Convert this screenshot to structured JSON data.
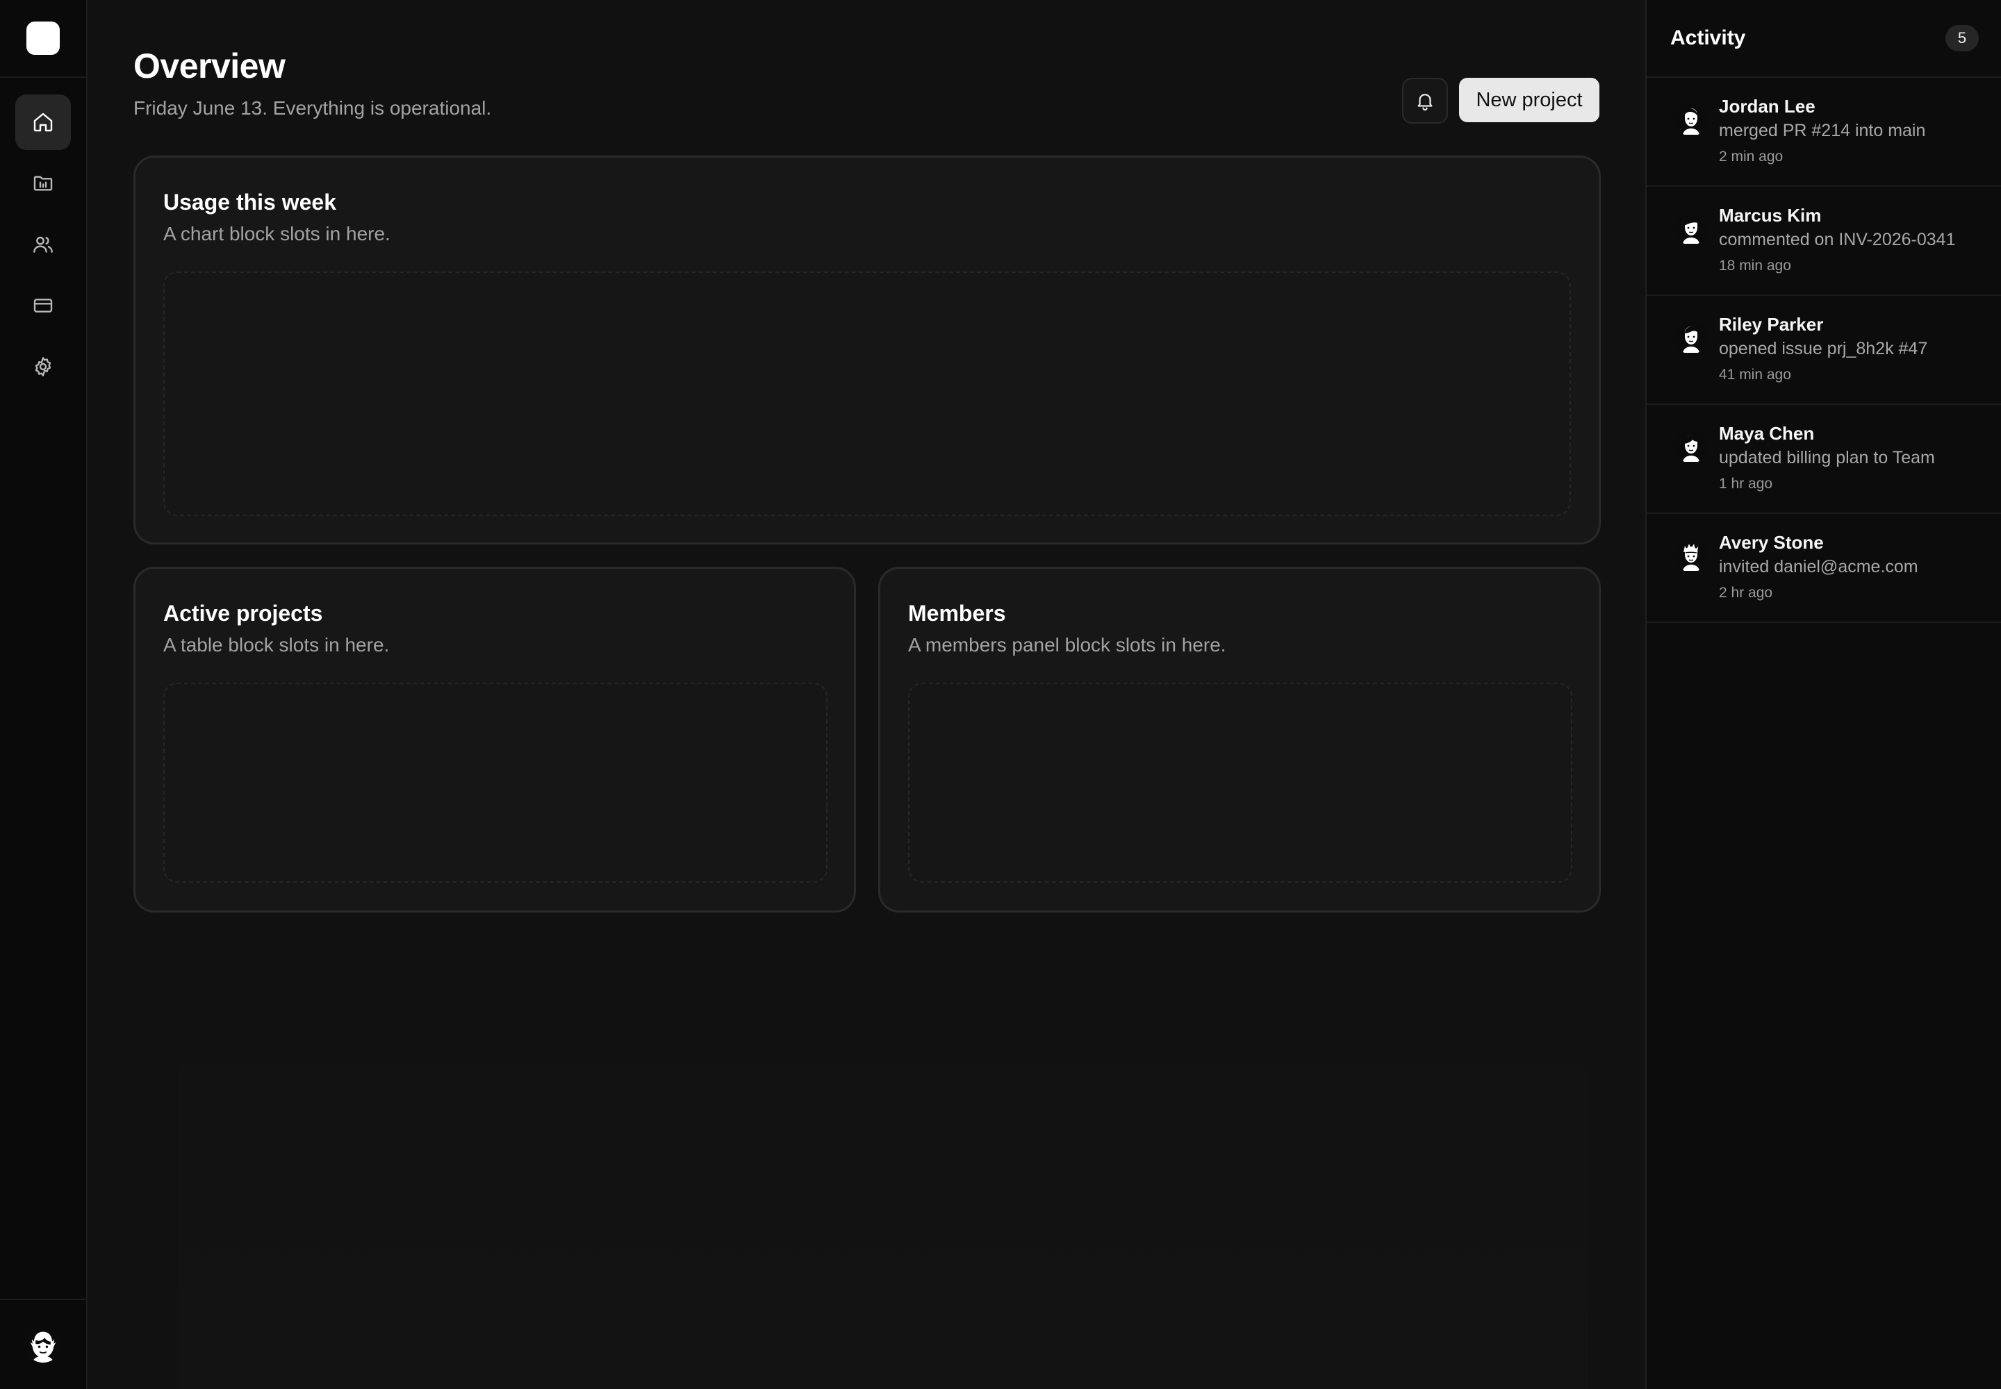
{
  "sidebar": {
    "nav": [
      {
        "icon": "home-icon",
        "active": true
      },
      {
        "icon": "folder-icon",
        "active": false
      },
      {
        "icon": "users-icon",
        "active": false
      },
      {
        "icon": "credit-card-icon",
        "active": false
      },
      {
        "icon": "gear-icon",
        "active": false
      }
    ]
  },
  "header": {
    "title": "Overview",
    "subtitle": "Friday June 13. Everything is operational.",
    "new_project_label": "New project"
  },
  "cards": {
    "usage": {
      "title": "Usage this week",
      "description": "A chart block slots in here."
    },
    "projects": {
      "title": "Active projects",
      "description": "A table block slots in here."
    },
    "members": {
      "title": "Members",
      "description": "A members panel block slots in here."
    }
  },
  "activity": {
    "title": "Activity",
    "count": "5",
    "items": [
      {
        "name": "Jordan Lee",
        "action": "merged PR #214 into main",
        "time": "2 min ago"
      },
      {
        "name": "Marcus Kim",
        "action": "commented on INV-2026-0341",
        "time": "18 min ago"
      },
      {
        "name": "Riley Parker",
        "action": "opened issue prj_8h2k #47",
        "time": "41 min ago"
      },
      {
        "name": "Maya Chen",
        "action": "updated billing plan to Team",
        "time": "1 hr ago"
      },
      {
        "name": "Avery Stone",
        "action": "invited daniel@acme.com",
        "time": "2 hr ago"
      }
    ]
  },
  "colors": {
    "background": "#111111",
    "rail": "#0a0a0a",
    "card": "#171717",
    "border": "#2a2a2a",
    "primary_button": "#e8e8e8",
    "muted_text": "#a3a3a3"
  }
}
